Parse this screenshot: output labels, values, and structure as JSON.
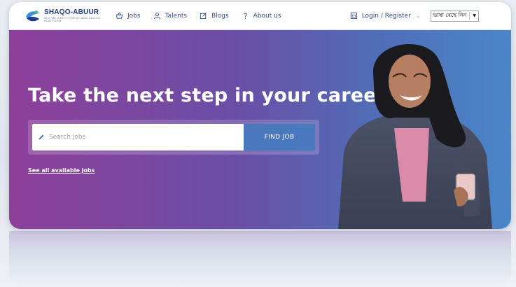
{
  "brand": {
    "title": "SHAQO-ABUUR",
    "subtitle": "DIGITAL EMPLOYMENT AND SKILLS PLATFORM",
    "colors": {
      "primary": "#1e3a8a",
      "accent": "#4a78bf",
      "gradient_start": "#8e3f9a",
      "gradient_end": "#4a86c8"
    }
  },
  "nav": {
    "items": [
      {
        "label": "Jobs",
        "icon": "basket-icon"
      },
      {
        "label": "Talents",
        "icon": "user-icon"
      },
      {
        "label": "Blogs",
        "icon": "edit-icon"
      },
      {
        "label": "About us",
        "icon": "question-icon"
      }
    ],
    "login_label": "Login / Register",
    "language": {
      "selected": "ভাষা বেছে নিন"
    }
  },
  "hero": {
    "title": "Take the next step in your career!",
    "search": {
      "placeholder": "Search jobs",
      "value": ""
    },
    "find_button": "FIND JOB",
    "all_jobs_link": "See all available jobs"
  }
}
